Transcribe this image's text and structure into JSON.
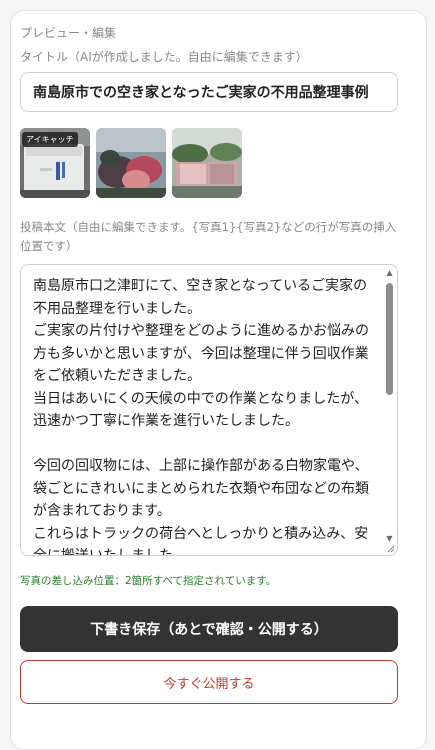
{
  "preview": {
    "section_label": "プレビュー・編集",
    "title_label": "タイトル（AIが作成しました。自由に編集できます）",
    "title_value": "南島原市での空き家となったご実家の不用品整理事例"
  },
  "thumbnails": {
    "eyecatch_badge": "アイキャッチ",
    "items": [
      {
        "icon": "appliance-photo"
      },
      {
        "icon": "bags-photo"
      },
      {
        "icon": "truck-load-photo"
      }
    ]
  },
  "body": {
    "label": "投稿本文（自由に編集できます。{写真1}{写真2}などの行が写真の挿入位置です）",
    "lines": [
      "南島原市口之津町にて、空き家となっているご実家の不用品整理を行いました。",
      "ご実家の片付けや整理をどのように進めるかお悩みの方も多いかと思いますが、今回は整理に伴う回収作業をご依頼いただきました。",
      "当日はあいにくの天候の中での作業となりましたが、迅速かつ丁寧に作業を進行いたしました。",
      "",
      "今回の回収物には、上部に操作部がある白物家電や、袋ごとにきれいにまとめられた衣類や布団などの布類が含まれております。",
      "これらはトラックの荷台へとしっかりと積み込み、安全に搬送いたしました。"
    ]
  },
  "status_note": "写真の差し込み位置：2箇所すべて指定されています。",
  "buttons": {
    "draft": "下書き保存（あとで確認・公開する）",
    "publish": "今すぐ公開する"
  },
  "colors": {
    "draft_bg": "#333333",
    "publish_accent": "#c0392b",
    "status_green": "#2e7d32"
  }
}
